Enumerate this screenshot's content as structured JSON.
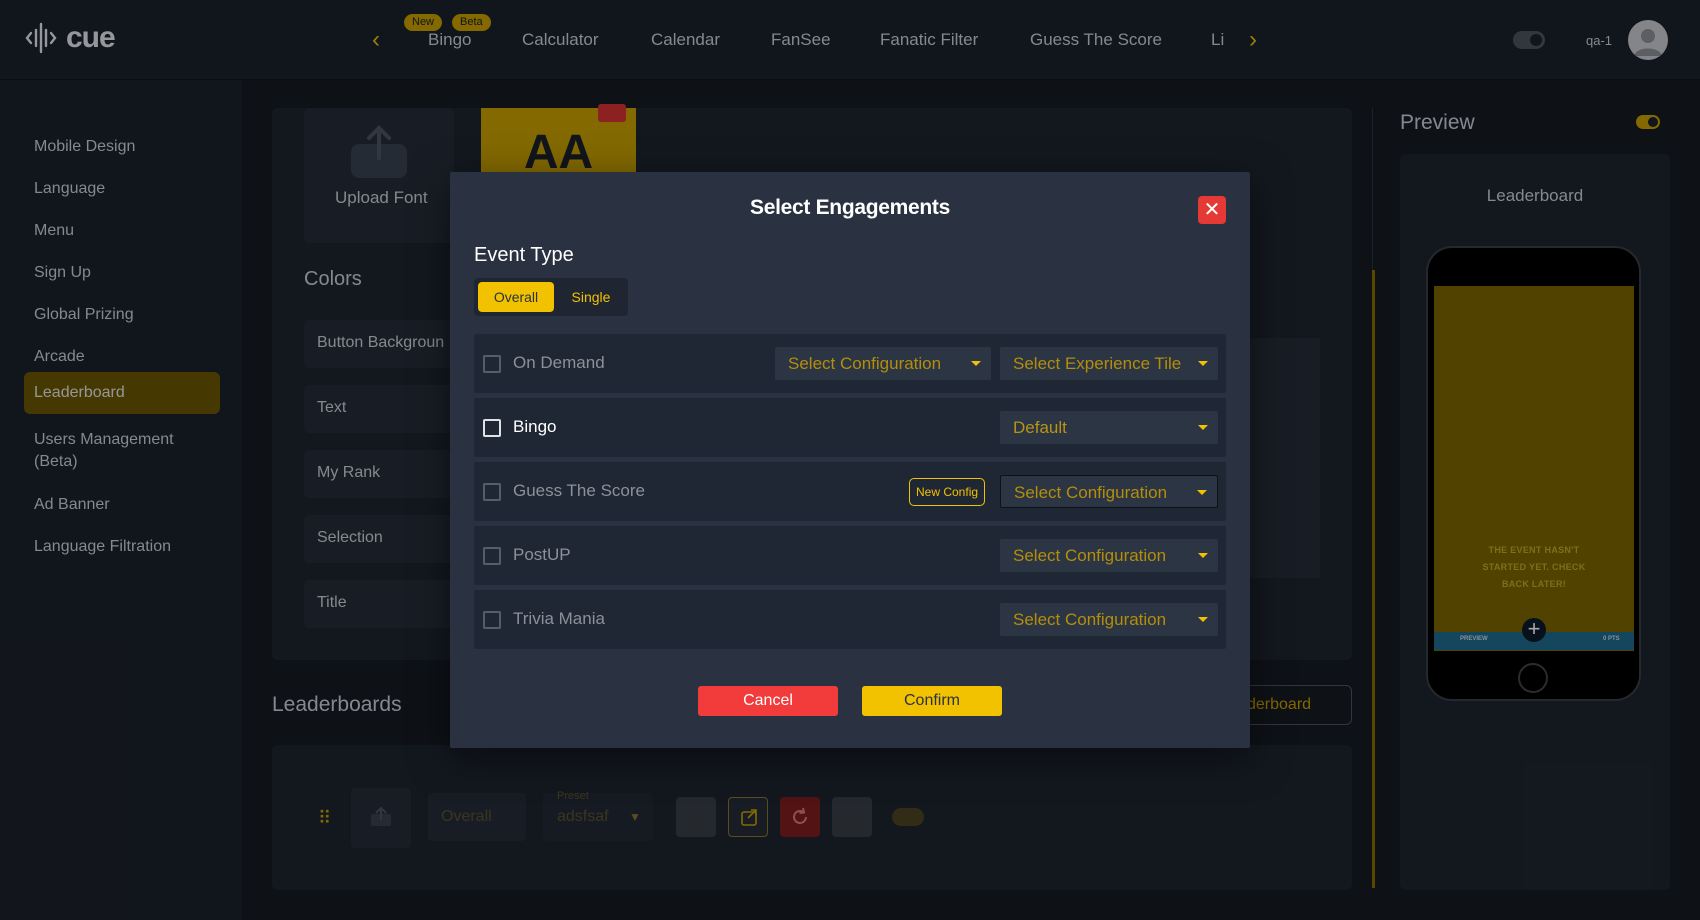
{
  "brand": {
    "name": "cue"
  },
  "topnav": {
    "items": [
      {
        "label": "Bingo"
      },
      {
        "label": "Calculator"
      },
      {
        "label": "Calendar"
      },
      {
        "label": "FanSee"
      },
      {
        "label": "Fanatic Filter"
      },
      {
        "label": "Guess The Score"
      },
      {
        "label": "Li"
      }
    ],
    "pill_new": "New",
    "pill_beta": "Beta"
  },
  "user": {
    "name": "qa-1"
  },
  "sidebar": {
    "items": [
      {
        "label": "Mobile Design"
      },
      {
        "label": "Language"
      },
      {
        "label": "Menu"
      },
      {
        "label": "Sign Up"
      },
      {
        "label": "Global Prizing"
      },
      {
        "label": "Arcade"
      },
      {
        "label": "Leaderboard"
      },
      {
        "label": "Users Management (Beta)"
      },
      {
        "label": "Ad Banner"
      },
      {
        "label": "Language Filtration"
      }
    ],
    "active_index": 6
  },
  "main": {
    "upload_font": "Upload Font",
    "font_tile": "AA",
    "colors_title": "Colors",
    "color_rows": [
      "Button Backgroun",
      "Text",
      "My Rank",
      "Selection",
      "Title"
    ],
    "leaderboards_title": "Leaderboards",
    "leaderboard_button": "derboard",
    "row": {
      "name": "Overall",
      "preset_label": "Preset",
      "preset_value": "adsfsaf"
    }
  },
  "preview": {
    "title": "Preview",
    "screen_title": "Leaderboard",
    "message": "THE EVENT HASN'T STARTED YET. CHECK BACK LATER!",
    "bar_left": "PREVIEW",
    "bar_right": "0 PTS"
  },
  "modal": {
    "title": "Select Engagements",
    "event_type_label": "Event Type",
    "event_types": [
      "Overall",
      "Single"
    ],
    "selected_event_type": "Overall",
    "engagements": [
      {
        "name": "On Demand",
        "checked": false,
        "dropdowns": [
          "Select Configuration",
          "Select Experience Tile"
        ]
      },
      {
        "name": "Bingo",
        "checked": false,
        "dropdowns": [
          "Default"
        ]
      },
      {
        "name": "Guess The Score",
        "checked": false,
        "new_config": "New Config",
        "dropdowns": [
          "Select Configuration"
        ]
      },
      {
        "name": "PostUP",
        "checked": false,
        "dropdowns": [
          "Select Configuration"
        ]
      },
      {
        "name": "Trivia Mania",
        "checked": false,
        "dropdowns": [
          "Select Configuration"
        ]
      }
    ],
    "cancel": "Cancel",
    "confirm": "Confirm"
  },
  "colors": {
    "accent": "#f2c200",
    "danger": "#e53935",
    "background": "#161b23"
  }
}
